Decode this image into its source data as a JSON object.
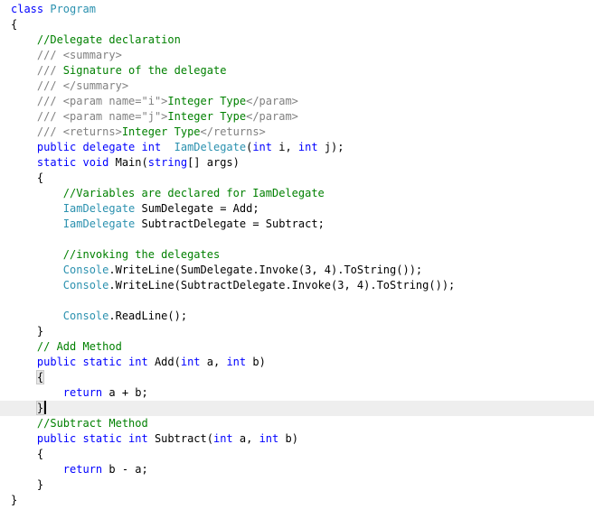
{
  "editor": {
    "caret_line": 26,
    "lines": [
      [
        {
          "t": "class ",
          "c": "kw"
        },
        {
          "t": "Program",
          "c": "ty"
        }
      ],
      [
        {
          "t": "{",
          "c": "pl"
        }
      ],
      [
        {
          "t": "    //Delegate declaration",
          "c": "cm"
        }
      ],
      [
        {
          "t": "    /// ",
          "c": "dc"
        },
        {
          "t": "<summary>",
          "c": "dc"
        }
      ],
      [
        {
          "t": "    /// ",
          "c": "dc"
        },
        {
          "t": "Signature of the delegate",
          "c": "cm"
        }
      ],
      [
        {
          "t": "    /// ",
          "c": "dc"
        },
        {
          "t": "</summary>",
          "c": "dc"
        }
      ],
      [
        {
          "t": "    /// ",
          "c": "dc"
        },
        {
          "t": "<param name=\"i\">",
          "c": "dc"
        },
        {
          "t": "Integer Type",
          "c": "cm"
        },
        {
          "t": "</param>",
          "c": "dc"
        }
      ],
      [
        {
          "t": "    /// ",
          "c": "dc"
        },
        {
          "t": "<param name=\"j\">",
          "c": "dc"
        },
        {
          "t": "Integer Type",
          "c": "cm"
        },
        {
          "t": "</param>",
          "c": "dc"
        }
      ],
      [
        {
          "t": "    /// ",
          "c": "dc"
        },
        {
          "t": "<returns>",
          "c": "dc"
        },
        {
          "t": "Integer Type",
          "c": "cm"
        },
        {
          "t": "</returns>",
          "c": "dc"
        }
      ],
      [
        {
          "t": "    public delegate int ",
          "c": "kw"
        },
        {
          "t": " IamDelegate",
          "c": "ty"
        },
        {
          "t": "(",
          "c": "pl"
        },
        {
          "t": "int",
          "c": "kw"
        },
        {
          "t": " i, ",
          "c": "pl"
        },
        {
          "t": "int",
          "c": "kw"
        },
        {
          "t": " j);",
          "c": "pl"
        }
      ],
      [
        {
          "t": "    static void ",
          "c": "kw"
        },
        {
          "t": "Main(",
          "c": "pl"
        },
        {
          "t": "string",
          "c": "kw"
        },
        {
          "t": "[] args)",
          "c": "pl"
        }
      ],
      [
        {
          "t": "    {",
          "c": "pl"
        }
      ],
      [
        {
          "t": "        //Variables are declared for IamDelegate",
          "c": "cm"
        }
      ],
      [
        {
          "t": "        ",
          "c": "pl"
        },
        {
          "t": "IamDelegate",
          "c": "ty"
        },
        {
          "t": " SumDelegate = Add;",
          "c": "pl"
        }
      ],
      [
        {
          "t": "        ",
          "c": "pl"
        },
        {
          "t": "IamDelegate",
          "c": "ty"
        },
        {
          "t": " SubtractDelegate = Subtract;",
          "c": "pl"
        }
      ],
      [
        {
          "t": "",
          "c": "pl"
        }
      ],
      [
        {
          "t": "        //invoking the delegates",
          "c": "cm"
        }
      ],
      [
        {
          "t": "        ",
          "c": "pl"
        },
        {
          "t": "Console",
          "c": "ty"
        },
        {
          "t": ".WriteLine(SumDelegate.Invoke(3, 4).ToString());",
          "c": "pl"
        }
      ],
      [
        {
          "t": "        ",
          "c": "pl"
        },
        {
          "t": "Console",
          "c": "ty"
        },
        {
          "t": ".WriteLine(SubtractDelegate.Invoke(3, 4).ToString());",
          "c": "pl"
        }
      ],
      [
        {
          "t": "",
          "c": "pl"
        }
      ],
      [
        {
          "t": "        ",
          "c": "pl"
        },
        {
          "t": "Console",
          "c": "ty"
        },
        {
          "t": ".ReadLine();",
          "c": "pl"
        }
      ],
      [
        {
          "t": "    }",
          "c": "pl"
        }
      ],
      [
        {
          "t": "    // Add Method",
          "c": "cm"
        }
      ],
      [
        {
          "t": "    public static int ",
          "c": "kw"
        },
        {
          "t": "Add(",
          "c": "pl"
        },
        {
          "t": "int",
          "c": "kw"
        },
        {
          "t": " a, ",
          "c": "pl"
        },
        {
          "t": "int",
          "c": "kw"
        },
        {
          "t": " b)",
          "c": "pl"
        }
      ],
      [
        {
          "t": "    ",
          "c": "pl"
        },
        {
          "t": "{",
          "c": "pl",
          "hl": true
        }
      ],
      [
        {
          "t": "        return ",
          "c": "kw"
        },
        {
          "t": "a + b;",
          "c": "pl"
        }
      ],
      [
        {
          "t": "    ",
          "c": "pl"
        },
        {
          "t": "}",
          "c": "pl",
          "hl": true
        }
      ],
      [
        {
          "t": "    //Subtract Method",
          "c": "cm"
        }
      ],
      [
        {
          "t": "    public static int ",
          "c": "kw"
        },
        {
          "t": "Subtract(",
          "c": "pl"
        },
        {
          "t": "int",
          "c": "kw"
        },
        {
          "t": " a, ",
          "c": "pl"
        },
        {
          "t": "int",
          "c": "kw"
        },
        {
          "t": " b)",
          "c": "pl"
        }
      ],
      [
        {
          "t": "    {",
          "c": "pl"
        }
      ],
      [
        {
          "t": "        return ",
          "c": "kw"
        },
        {
          "t": "b - a;",
          "c": "pl"
        }
      ],
      [
        {
          "t": "    }",
          "c": "pl"
        }
      ],
      [
        {
          "t": "}",
          "c": "pl"
        }
      ]
    ]
  }
}
